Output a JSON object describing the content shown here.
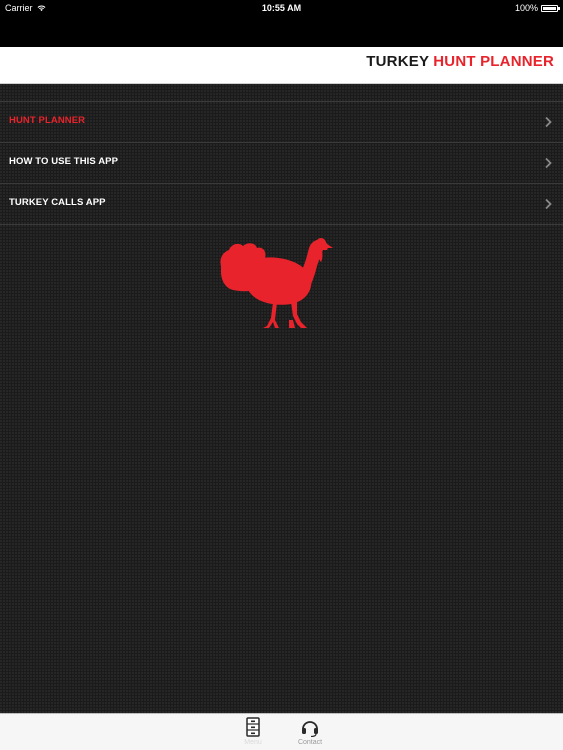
{
  "status_bar": {
    "carrier": "Carrier",
    "time": "10:55 AM",
    "battery": "100%",
    "wifi_icon": "wifi-icon",
    "battery_icon": "battery-icon"
  },
  "header": {
    "title_part1": "TURKEY",
    "title_part2": "HUNT PLANNER",
    "accent_color": "#e8232b"
  },
  "menu": {
    "items": [
      {
        "label": "HUNT PLANNER",
        "active": true,
        "icon": "chevron-right-icon"
      },
      {
        "label": "HOW TO USE THIS APP",
        "active": false,
        "icon": "chevron-right-icon"
      },
      {
        "label": "TURKEY CALLS APP",
        "active": false,
        "icon": "chevron-right-icon"
      }
    ]
  },
  "main": {
    "logo_icon": "turkey-silhouette-icon",
    "logo_color": "#e8232b"
  },
  "tabbar": {
    "tabs": [
      {
        "label": "Menu",
        "icon": "menu-cabinet-icon",
        "selected": true
      },
      {
        "label": "Contact",
        "icon": "headset-icon",
        "selected": false
      }
    ]
  }
}
